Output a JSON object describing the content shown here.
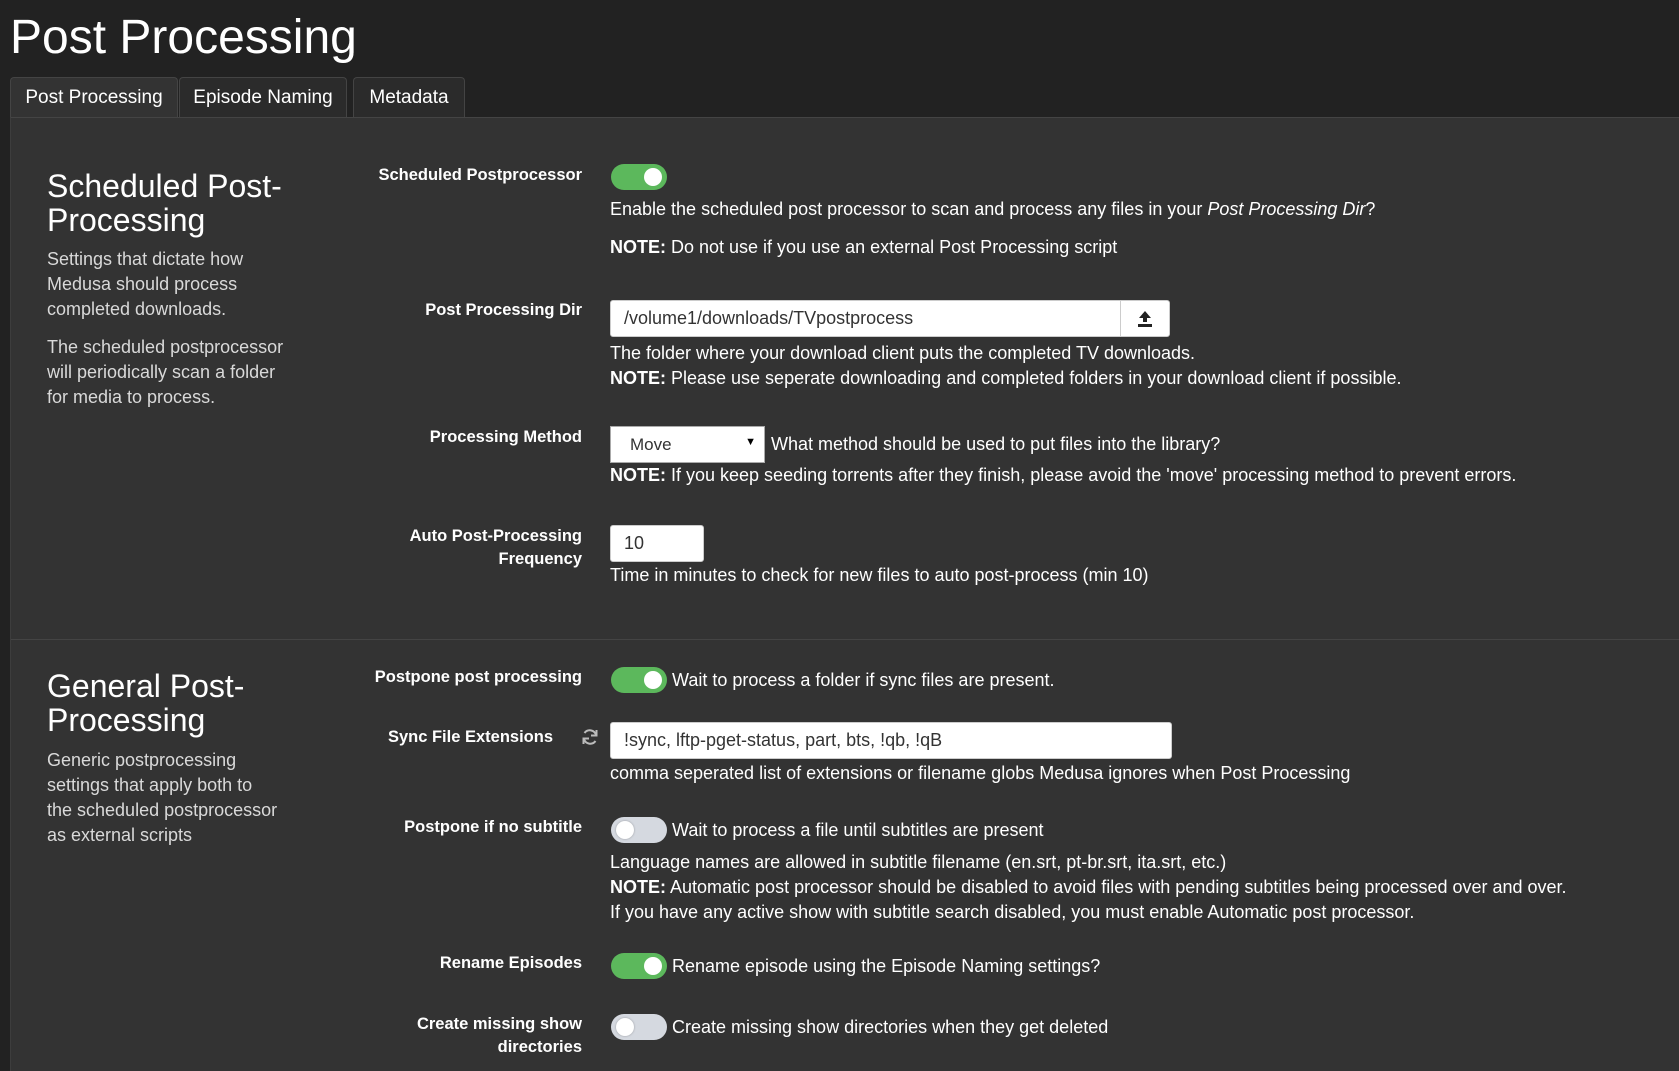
{
  "page": {
    "title": "Post Processing"
  },
  "tabs": [
    {
      "label": "Post Processing",
      "active": true
    },
    {
      "label": "Episode Naming",
      "active": false
    },
    {
      "label": "Metadata",
      "active": false
    }
  ],
  "scheduled": {
    "title_line1": "Scheduled Post-",
    "title_line2": "Processing",
    "desc1": [
      "Settings that dictate how",
      "Medusa should process",
      "completed downloads."
    ],
    "desc2": [
      "The scheduled postprocessor",
      "will periodically scan a folder",
      "for media to process."
    ],
    "postprocessor": {
      "label": "Scheduled Postprocessor",
      "enabled": true,
      "help_prefix": "Enable the scheduled post processor to scan and process any files in your ",
      "help_emph": "Post Processing Dir",
      "help_suffix": "?",
      "note_label": "NOTE:",
      "note_text": " Do not use if you use an external Post Processing script"
    },
    "dir": {
      "label": "Post Processing Dir",
      "value": "/volume1/downloads/TVpostprocess",
      "help": "The folder where your download client puts the completed TV downloads.",
      "note_label": "NOTE:",
      "note_text": " Please use seperate downloading and completed folders in your download client if possible."
    },
    "method": {
      "label": "Processing Method",
      "selected": "Move",
      "help": "What method should be used to put files into the library?",
      "note_label": "NOTE:",
      "note_text": " If you keep seeding torrents after they finish, please avoid the 'move' processing method to prevent errors."
    },
    "frequency": {
      "label_line1": "Auto Post-Processing",
      "label_line2": "Frequency",
      "value": "10",
      "help": "Time in minutes to check for new files to auto post-process (min 10)"
    }
  },
  "general": {
    "title_line1": "General Post-",
    "title_line2": "Processing",
    "desc": [
      "Generic postprocessing",
      "settings that apply both to",
      "the scheduled postprocessor",
      "as external scripts"
    ],
    "postpone": {
      "label": "Postpone post processing",
      "enabled": true,
      "help": "Wait to process a folder if sync files are present."
    },
    "sync": {
      "label": "Sync File Extensions",
      "value": "!sync, lftp-pget-status, part, bts, !qb, !qB",
      "help": "comma seperated list of extensions or filename globs Medusa ignores when Post Processing"
    },
    "subtitle": {
      "label": "Postpone if no subtitle",
      "enabled": false,
      "help": "Wait to process a file until subtitles are present",
      "line2": "Language names are allowed in subtitle filename (en.srt, pt-br.srt, ita.srt, etc.)",
      "note_label": "NOTE:",
      "note_text": " Automatic post processor should be disabled to avoid files with pending subtitles being processed over and over.",
      "line4": "If you have any active show with subtitle search disabled, you must enable Automatic post processor."
    },
    "rename": {
      "label": "Rename Episodes",
      "enabled": true,
      "help": "Rename episode using the Episode Naming settings?"
    },
    "missing": {
      "label_line1": "Create missing show",
      "label_line2": "directories",
      "enabled": false,
      "help": "Create missing show directories when they get deleted"
    }
  },
  "colors": {
    "background": "#222222",
    "panel": "#333333",
    "toggle_on": "#5cb85c",
    "toggle_off": "#d5d9e0"
  },
  "icons": {
    "browse": "upload-icon",
    "refresh": "refresh-icon",
    "dropdown": "caret-down-icon"
  }
}
